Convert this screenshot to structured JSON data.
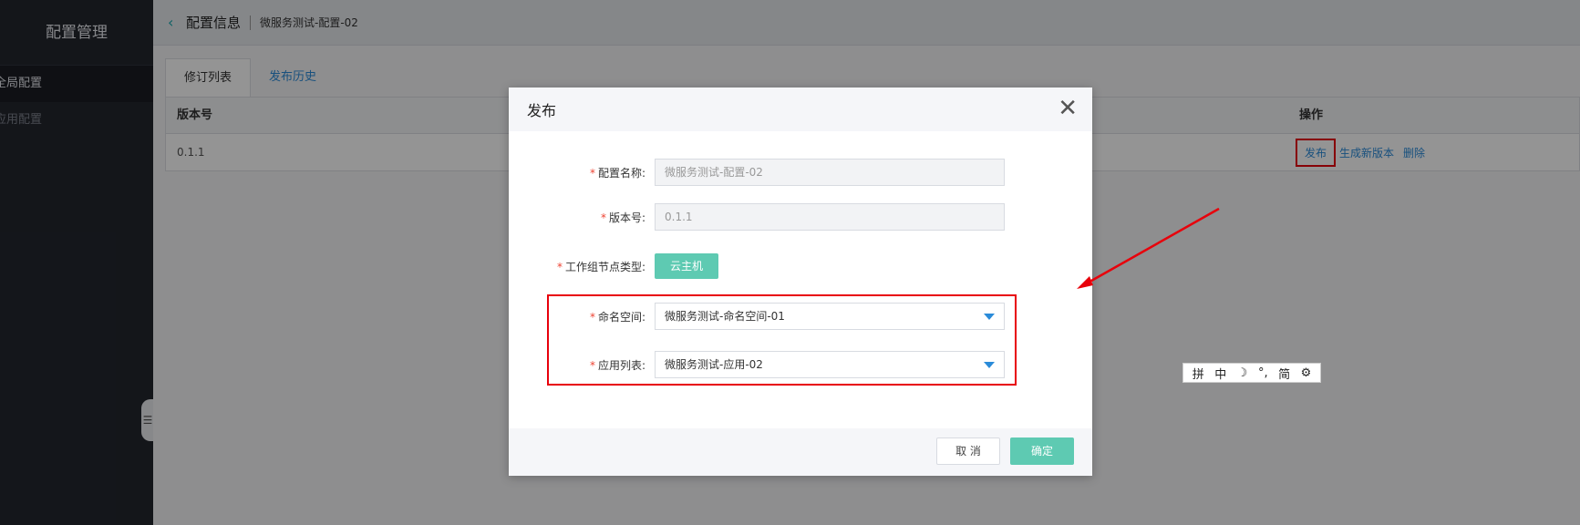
{
  "sidebar": {
    "title": "配置管理",
    "items": [
      {
        "label": "全局配置"
      },
      {
        "label": "应用配置"
      }
    ]
  },
  "header": {
    "title": "配置信息",
    "subtitle": "微服务测试-配置-02"
  },
  "tabs": [
    {
      "label": "修订列表"
    },
    {
      "label": "发布历史"
    }
  ],
  "table": {
    "columns": [
      "版本号",
      "操作"
    ],
    "rows": [
      {
        "version": "0.1.1",
        "actions": [
          "发布",
          "生成新版本",
          "删除"
        ]
      }
    ]
  },
  "modal": {
    "title": "发布",
    "fields": {
      "config_name": {
        "label": "配置名称:",
        "value": "微服务测试-配置-02"
      },
      "version": {
        "label": "版本号:",
        "value": "0.1.1"
      },
      "node_type": {
        "label": "工作组节点类型:",
        "value": "云主机"
      },
      "namespace": {
        "label": "命名空间:",
        "value": "微服务测试-命名空间-01"
      },
      "app_list": {
        "label": "应用列表:",
        "value": "微服务测试-应用-02"
      }
    },
    "cancel_label": "取 消",
    "ok_label": "确定"
  },
  "ime_toolbar": {
    "items": [
      "拼",
      "中",
      "☽",
      "°,",
      "简",
      "⚙"
    ]
  },
  "colors": {
    "accent": "#2a8bd9",
    "primary_button": "#5ecab2",
    "highlight": "#e8000b",
    "sidebar_bg": "#23262e"
  }
}
